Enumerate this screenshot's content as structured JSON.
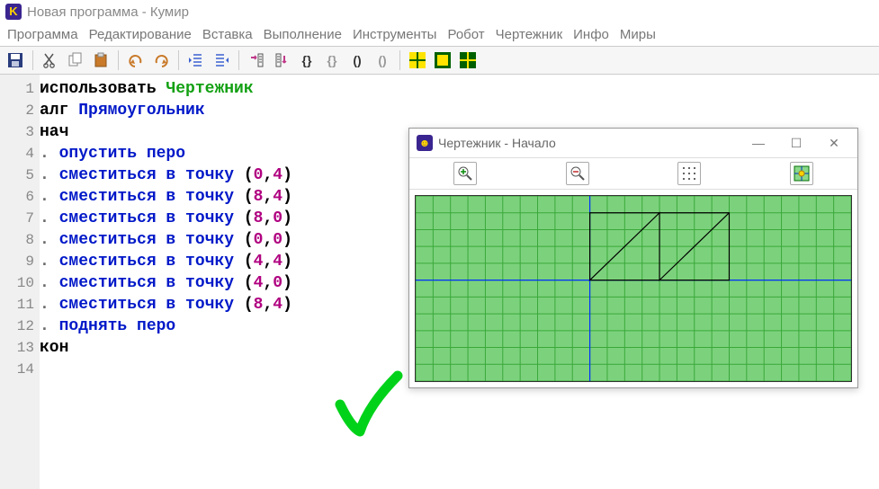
{
  "window": {
    "title": "Новая программа - Кумир"
  },
  "menu": [
    "Программа",
    "Редактирование",
    "Вставка",
    "Выполнение",
    "Инструменты",
    "Робот",
    "Чертежник",
    "Инфо",
    "Миры"
  ],
  "code": {
    "lines": [
      {
        "n": 1,
        "tokens": [
          [
            "kw-black",
            "использовать "
          ],
          [
            "kw-green",
            "Чертежник"
          ]
        ]
      },
      {
        "n": 2,
        "tokens": [
          [
            "kw-black",
            "алг "
          ],
          [
            "kw-blue",
            "Прямоугольник"
          ]
        ]
      },
      {
        "n": 3,
        "tokens": [
          [
            "kw-black",
            "нач"
          ]
        ]
      },
      {
        "n": 4,
        "tokens": [
          [
            "kw-gray",
            ". "
          ],
          [
            "kw-blue",
            "опустить перо"
          ]
        ]
      },
      {
        "n": 5,
        "tokens": [
          [
            "kw-gray",
            ". "
          ],
          [
            "kw-blue",
            "сместиться в точку "
          ],
          [
            "kw-black",
            "("
          ],
          [
            "kw-magenta",
            "0"
          ],
          [
            "kw-black",
            ","
          ],
          [
            "kw-magenta",
            "4"
          ],
          [
            "kw-black",
            ")"
          ]
        ]
      },
      {
        "n": 6,
        "tokens": [
          [
            "kw-gray",
            ". "
          ],
          [
            "kw-blue",
            "сместиться в точку "
          ],
          [
            "kw-black",
            "("
          ],
          [
            "kw-magenta",
            "8"
          ],
          [
            "kw-black",
            ","
          ],
          [
            "kw-magenta",
            "4"
          ],
          [
            "kw-black",
            ")"
          ]
        ]
      },
      {
        "n": 7,
        "tokens": [
          [
            "kw-gray",
            ". "
          ],
          [
            "kw-blue",
            "сместиться в точку "
          ],
          [
            "kw-black",
            "("
          ],
          [
            "kw-magenta",
            "8"
          ],
          [
            "kw-black",
            ","
          ],
          [
            "kw-magenta",
            "0"
          ],
          [
            "kw-black",
            ")"
          ]
        ]
      },
      {
        "n": 8,
        "tokens": [
          [
            "kw-gray",
            ". "
          ],
          [
            "kw-blue",
            "сместиться в точку "
          ],
          [
            "kw-black",
            "("
          ],
          [
            "kw-magenta",
            "0"
          ],
          [
            "kw-black",
            ","
          ],
          [
            "kw-magenta",
            "0"
          ],
          [
            "kw-black",
            ")"
          ]
        ]
      },
      {
        "n": 9,
        "tokens": [
          [
            "kw-gray",
            ". "
          ],
          [
            "kw-blue",
            "сместиться в точку "
          ],
          [
            "kw-black",
            "("
          ],
          [
            "kw-magenta",
            "4"
          ],
          [
            "kw-black",
            ","
          ],
          [
            "kw-magenta",
            "4"
          ],
          [
            "kw-black",
            ")"
          ]
        ]
      },
      {
        "n": 10,
        "tokens": [
          [
            "kw-gray",
            ". "
          ],
          [
            "kw-blue",
            "сместиться в точку "
          ],
          [
            "kw-black",
            "("
          ],
          [
            "kw-magenta",
            "4"
          ],
          [
            "kw-black",
            ","
          ],
          [
            "kw-magenta",
            "0"
          ],
          [
            "kw-black",
            ")"
          ]
        ]
      },
      {
        "n": 11,
        "tokens": [
          [
            "kw-gray",
            ". "
          ],
          [
            "kw-blue",
            "сместиться в точку "
          ],
          [
            "kw-black",
            "("
          ],
          [
            "kw-magenta",
            "8"
          ],
          [
            "kw-black",
            ","
          ],
          [
            "kw-magenta",
            "4"
          ],
          [
            "kw-black",
            ")"
          ]
        ]
      },
      {
        "n": 12,
        "tokens": [
          [
            "kw-gray",
            ". "
          ],
          [
            "kw-blue",
            "поднять перо"
          ]
        ]
      },
      {
        "n": 13,
        "tokens": [
          [
            "kw-black",
            "кон"
          ]
        ]
      },
      {
        "n": 14,
        "tokens": []
      }
    ]
  },
  "draw_window": {
    "title": "Чертежник - Начало"
  },
  "chart_data": {
    "type": "line",
    "title": "Чертежник - Начало",
    "xlim": [
      -10,
      15
    ],
    "ylim": [
      -6,
      5
    ],
    "grid": true,
    "axes_at_zero": true,
    "path": [
      [
        0,
        0
      ],
      [
        0,
        4
      ],
      [
        8,
        4
      ],
      [
        8,
        0
      ],
      [
        0,
        0
      ],
      [
        4,
        4
      ],
      [
        4,
        0
      ],
      [
        8,
        4
      ]
    ]
  }
}
